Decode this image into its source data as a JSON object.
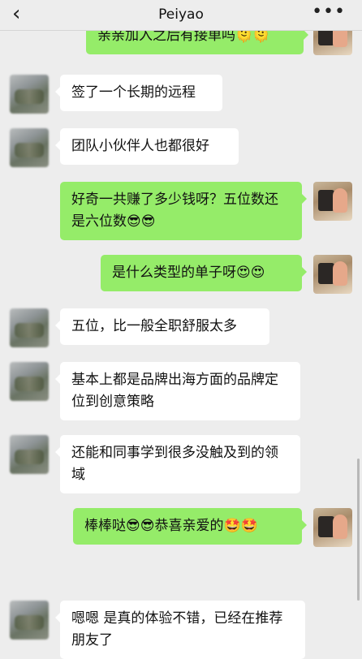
{
  "header": {
    "back_icon": "chevron-left-icon",
    "title": "Peiyao",
    "more_icon": "more-dots-icon"
  },
  "messages": [
    {
      "side": "right",
      "text": "亲亲加入之后有接单吗🫠🫠"
    },
    {
      "side": "left",
      "text": "签了一个长期的远程"
    },
    {
      "side": "left",
      "text": "团队小伙伴人也都很好"
    },
    {
      "side": "right",
      "text": "好奇一共赚了多少钱呀？五位数还是六位数😎😎"
    },
    {
      "side": "right",
      "text": "是什么类型的单子呀😍😍"
    },
    {
      "side": "left",
      "text": "五位，比一般全职舒服太多"
    },
    {
      "side": "left",
      "text": "基本上都是品牌出海方面的品牌定位到创意策略"
    },
    {
      "side": "left",
      "text": "还能和同事学到很多没触及到的领域"
    },
    {
      "side": "right",
      "text": "棒棒哒😎😎恭喜亲爱的🤩🤩"
    },
    {
      "side": "left",
      "text": "嗯嗯 是真的体验不错，已经在推荐朋友了"
    }
  ]
}
